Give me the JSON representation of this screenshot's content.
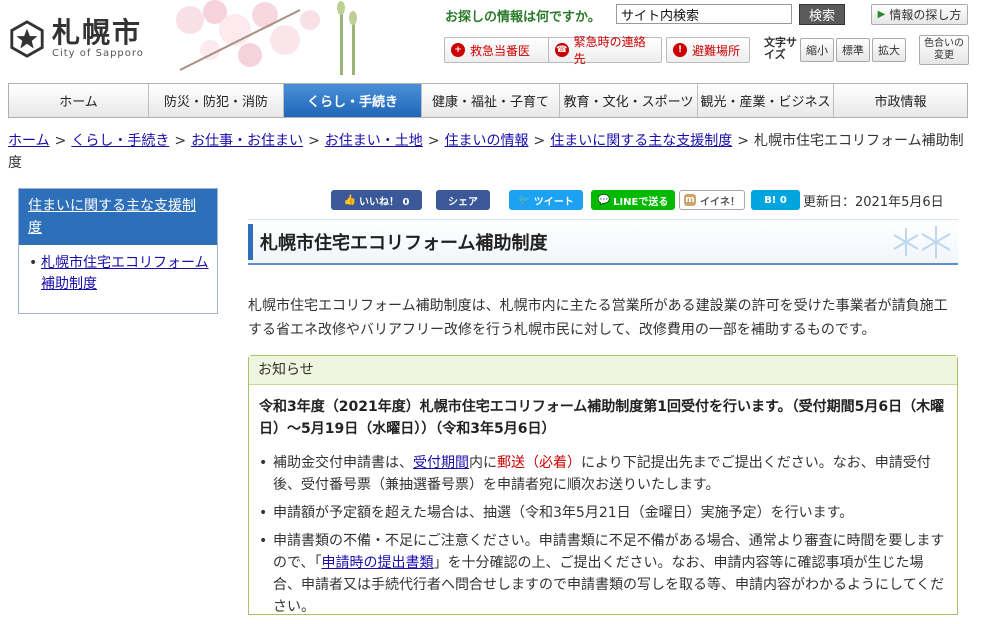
{
  "header": {
    "logo_name": "札幌市",
    "logo_sub": "City of Sapporo",
    "search_question": "お探しの情報は何ですか。",
    "search_value": "サイト内検索",
    "search_button": "検索",
    "info_button": "情報の探し方",
    "emergency": [
      {
        "label": "救急当番医",
        "icon": "hospital-icon"
      },
      {
        "label": "緊急時の連絡先",
        "icon": "phone-icon"
      },
      {
        "label": "避難場所",
        "icon": "evacuation-icon"
      }
    ],
    "font_size_label": "文字サイズ",
    "font_size_buttons": [
      "縮小",
      "標準",
      "拡大"
    ],
    "color_change": "色合いの変更"
  },
  "nav": {
    "items": [
      "ホーム",
      "防災・防犯・消防",
      "くらし・手続き",
      "健康・福祉・子育て",
      "教育・文化・スポーツ",
      "観光・産業・ビジネス",
      "市政情報"
    ],
    "active_index": 2
  },
  "breadcrumb": {
    "links": [
      "ホーム",
      "くらし・手続き",
      "お仕事・お住まい",
      "お住まい・土地",
      "住まいの情報",
      "住まいに関する主な支援制度"
    ],
    "current": "札幌市住宅エコリフォーム補助制度",
    "separator": ">"
  },
  "sidebar": {
    "heading": "住まいに関する主な支援制度",
    "items": [
      "札幌市住宅エコリフォーム補助制度"
    ]
  },
  "social": {
    "like": "いいね！ 0",
    "share": "シェア",
    "tweet": "ツイート",
    "line": "LINEで送る",
    "mixi": "イイネ！",
    "hatena": "B! 0"
  },
  "updated": "更新日：2021年5月6日",
  "page_title": "札幌市住宅エコリフォーム補助制度",
  "intro": "札幌市住宅エコリフォーム補助制度は、札幌市内に主たる営業所がある建設業の許可を受けた事業者が請負施工する省エネ改修やバリアフリー改修を行う札幌市民に対して、改修費用の一部を補助するものです。",
  "notice": {
    "heading": "お知らせ",
    "title": "令和3年度（2021年度）札幌市住宅エコリフォーム補助制度第1回受付を行います。（受付期間5月6日（木曜日）～5月19日（水曜日））（令和3年5月6日）",
    "item1_pre": "補助金交付申請書は、",
    "item1_link": "受付期間",
    "item1_mid": "内に",
    "item1_red": "郵送（必着）",
    "item1_post": "により下記提出先までご提出ください。なお、申請受付後、受付番号票（兼抽選番号票）を申請者宛に順次お送りいたします。",
    "item2": "申請額が予定額を超えた場合は、抽選（令和3年5月21日（金曜日）実施予定）を行います。",
    "item3_pre": "申請書類の不備・不足にご注意ください。申請書類に不足不備がある場合、通常より審査に時間を要しますので、「",
    "item3_link": "申請時の提出書類",
    "item3_post": "」を十分確認の上、ご提出ください。なお、申請内容等に確認事項が生じた場合、申請者又は手続代行者へ問合せしますので申請書類の写しを取る等、申請内容がわかるようにしてください。"
  },
  "colors": {
    "nav_active": "#1f66b8",
    "sidebar_head": "#2e6fba",
    "notice_border": "#a9c06e",
    "facebook": "#3b5998",
    "twitter": "#1da1f2",
    "line": "#00b900",
    "hatena": "#00a4de"
  }
}
